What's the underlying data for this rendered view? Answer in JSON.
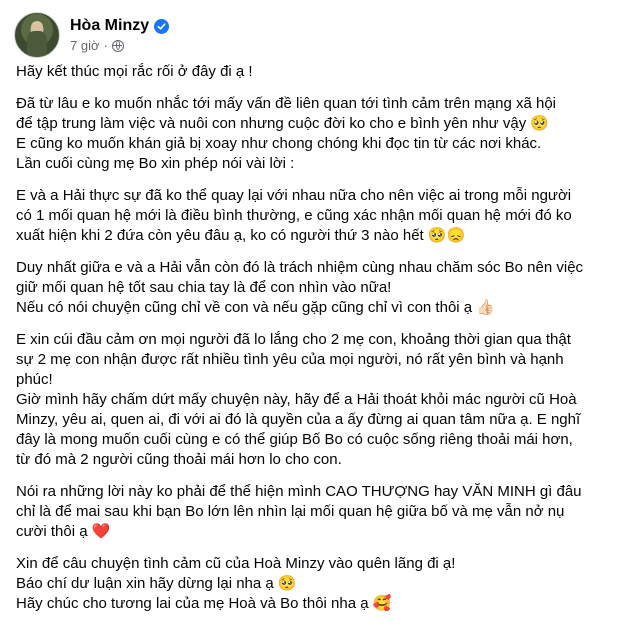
{
  "author": {
    "name": "Hòa Minzy",
    "time": "7 giờ",
    "separator": "·"
  },
  "icons": {
    "verified": "verified-badge-icon",
    "audience": "globe-icon",
    "brand_color": "#1877f2"
  },
  "post": {
    "p1": [
      "Hãy kết thúc mọi rắc rối ở đây đi ạ !"
    ],
    "p2": [
      "Đã từ lâu e ko muốn nhắc tới mấy vấn đề liên quan tới tình cảm trên mạng xã hội",
      "để tập trung làm việc và nuôi con nhưng cuộc đời ko cho e bình yên như vậy 🥺",
      "E cũng ko muốn khán giả bị xoay như chong chóng khi đọc tin từ các nơi khác.",
      "Lần cuối cùng mẹ Bo xin phép nói vài lời :"
    ],
    "p3": [
      "E và a Hải thực sự đã ko thể quay lại với nhau nữa cho nên việc ai trong mỗi người",
      "có 1 mối quan hệ mới là điều bình thường, e cũng xác nhận mối quan hệ mới đó ko",
      "xuất hiện khi 2 đứa còn yêu đâu ạ, ko có người thứ 3 nào hết 🥺😞"
    ],
    "p4": [
      "Duy nhất giữa e và a Hải vẫn còn đó là trách nhiệm cùng nhau chăm sóc Bo nên việc",
      "giữ mối quan hệ tốt sau chia tay là để con nhìn vào nữa!",
      "Nếu có nói chuyện cũng chỉ về con và nếu gặp cũng chỉ vì con thôi ạ 👍🏻"
    ],
    "p5": [
      "E xin cúi đầu cảm ơn mọi người đã lo lắng cho 2 mẹ con, khoảng thời gian qua thật",
      "sự 2 mẹ con nhận được rất nhiều tình yêu của mọi người, nó rất yên bình và hạnh",
      "phúc!",
      "Giờ mình hãy chấm dứt mấy chuyện này, hãy để a Hải thoát khỏi mác người cũ Hoà",
      "Minzy, yêu ai, quen ai, đi với ai đó là quyền của a ấy đừng ai quan tâm nữa ạ. E nghĩ",
      "đây là mong muốn cuối cùng e có thể giúp Bố Bo có cuộc sống riêng thoải mái hơn,",
      "từ đó mà 2 người cũng thoải mái hơn lo cho con."
    ],
    "p6": [
      "Nói ra những lời này ko phải để thể hiện mình CAO THƯỢNG hay VĂN MINH gì đâu",
      "chỉ là để mai sau khi bạn Bo lớn lên nhìn lại mối quan hệ giữa bố và mẹ vẫn nở nụ",
      "cười thôi ạ ❤️"
    ],
    "p7": [
      "Xin để câu chuyện tình cảm cũ của Hoà Minzy vào quên lãng đi ạ!",
      "Báo chí dư luận xin hãy dừng lại nha ạ 🥺",
      "Hãy chúc cho tương lai của mẹ Hoà và Bo thôi nha ạ 🥰"
    ]
  }
}
